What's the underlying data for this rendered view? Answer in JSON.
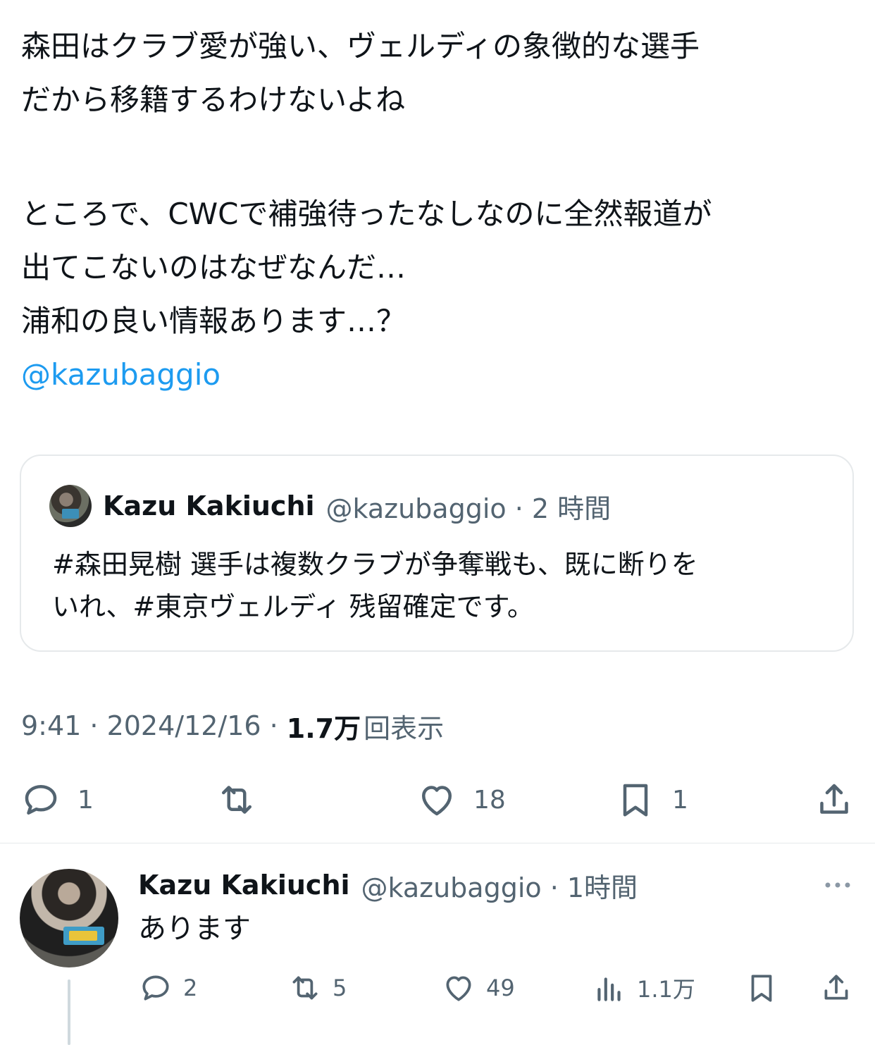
{
  "tweet": {
    "text_lines": [
      "森田はクラブ愛が強い、ヴェルディの象徴的な選手",
      "だから移籍するわけないよね",
      "",
      "ところで、CWCで補強待ったなしなのに全然報道が",
      "出てこないのはなぜなんだ…",
      "浦和の良い情報あります…？"
    ],
    "mention": "@kazubaggio"
  },
  "quote": {
    "name": "Kazu Kakiuchi",
    "meta": "@kazubaggio · 2 時間",
    "body_lines": [
      "#森田晃樹 選手は複数クラブが争奪戦も、既に断りを",
      "いれ、#東京ヴェルディ 残留確定です。"
    ]
  },
  "timestamp": {
    "time_date": "9:41 · 2024/12/16 ·",
    "views_count": "1.7万",
    "views_label": "回表示"
  },
  "actions": {
    "reply_count": "1",
    "retweet_count": "",
    "like_count": "18",
    "bookmark_count": "1"
  },
  "reply": {
    "name": "Kazu Kakiuchi",
    "meta": "@kazubaggio · 1時間",
    "text": "あります",
    "reply_count": "2",
    "retweet_count": "5",
    "like_count": "49",
    "views_count": "1.1万"
  },
  "colors": {
    "link": "#1d9bf0",
    "secondary_text": "#536471",
    "primary_text": "#0f1419",
    "border": "#e6e9eb"
  },
  "icons": {
    "reply": "reply-icon",
    "retweet": "retweet-icon",
    "like": "heart-icon",
    "bookmark": "bookmark-icon",
    "share": "share-icon",
    "views": "views-chart-icon",
    "more": "more-icon"
  }
}
